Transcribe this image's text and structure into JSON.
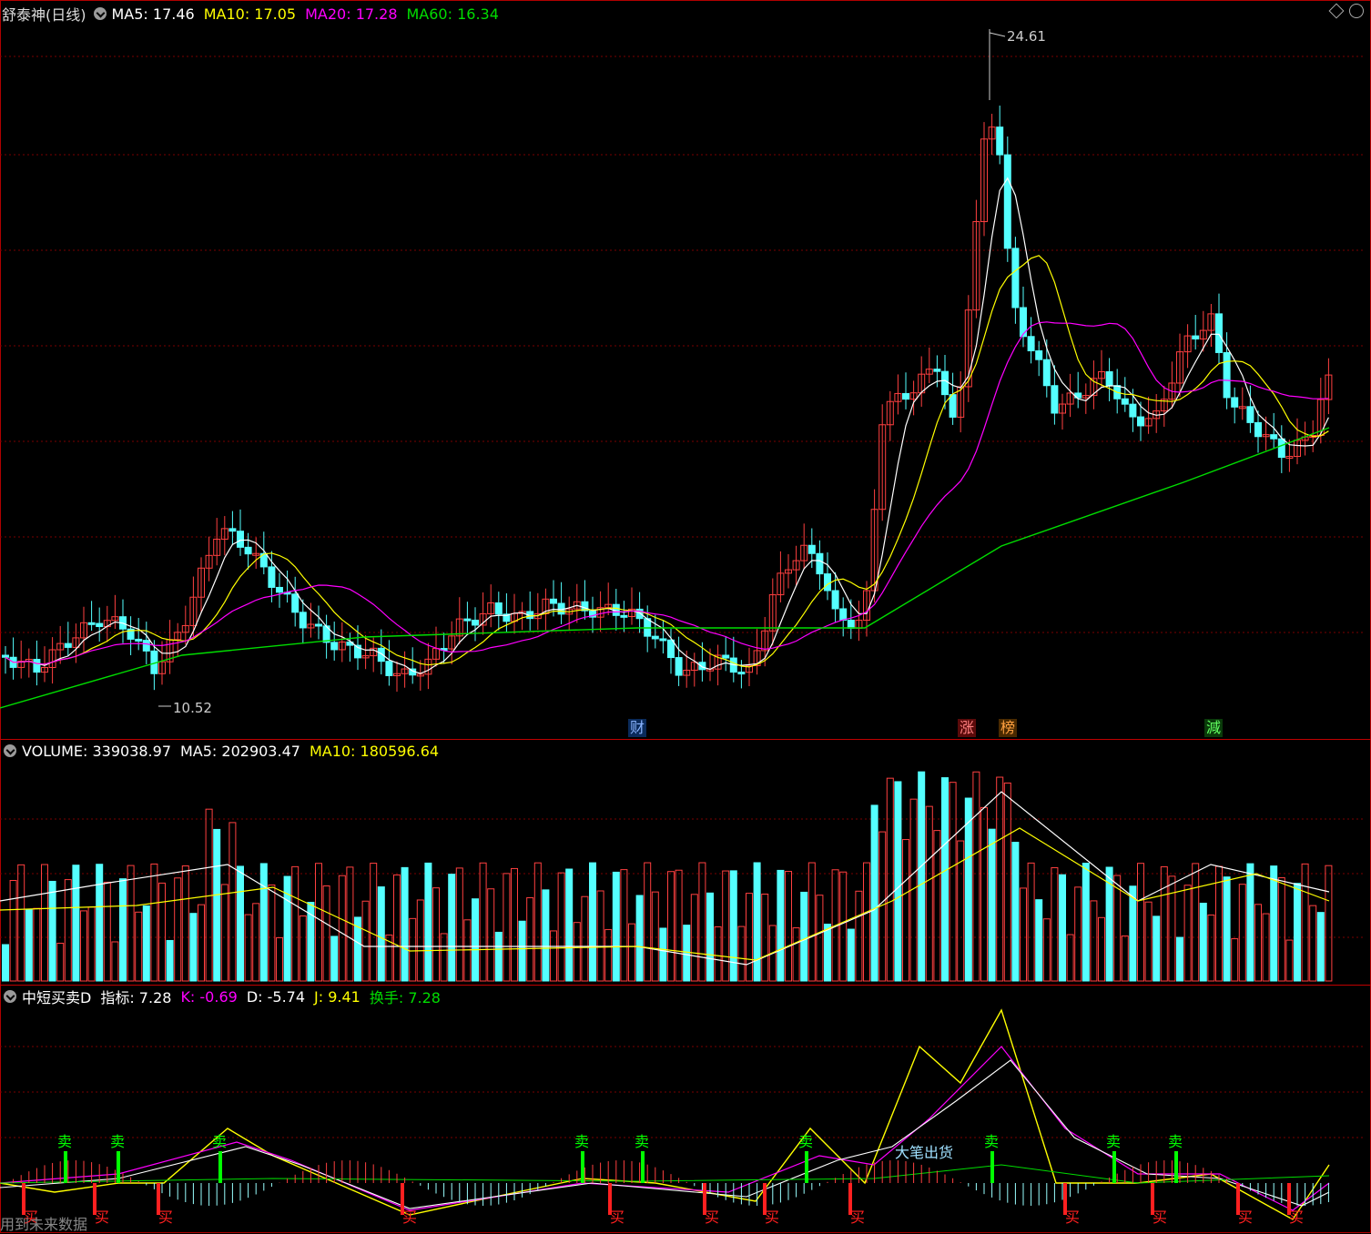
{
  "main_legend": {
    "title": "舒泰神(日线)",
    "ma5": "MA5: 17.46",
    "ma10": "MA10: 17.05",
    "ma20": "MA20: 17.28",
    "ma60": "MA60: 16.34"
  },
  "volume_legend": {
    "title": "VOLUME: 339038.97",
    "ma5": "MA5: 202903.47",
    "ma10": "MA10: 180596.64"
  },
  "indicator_legend": {
    "title": "中短买卖D",
    "index": "指标: 7.28",
    "k": "K: -0.69",
    "d": "D: -5.74",
    "j": "J: 9.41",
    "turnover": "换手: 7.28"
  },
  "markers": {
    "high": "24.61",
    "low": "10.52",
    "event_cai": "财",
    "event_zhang": "涨",
    "event_bang": "榜",
    "event_jian": "減"
  },
  "signals": {
    "sell": "卖",
    "buy": "买",
    "big_out": "大笔出货"
  },
  "footnote": "用到未来数据",
  "colors": {
    "up": "#ff4040",
    "down": "#54ffff",
    "ma5": "#ffffff",
    "ma10": "#ffff00",
    "ma20": "#ff00ff",
    "ma60": "#00dd00",
    "grid": "#7a0000"
  }
}
